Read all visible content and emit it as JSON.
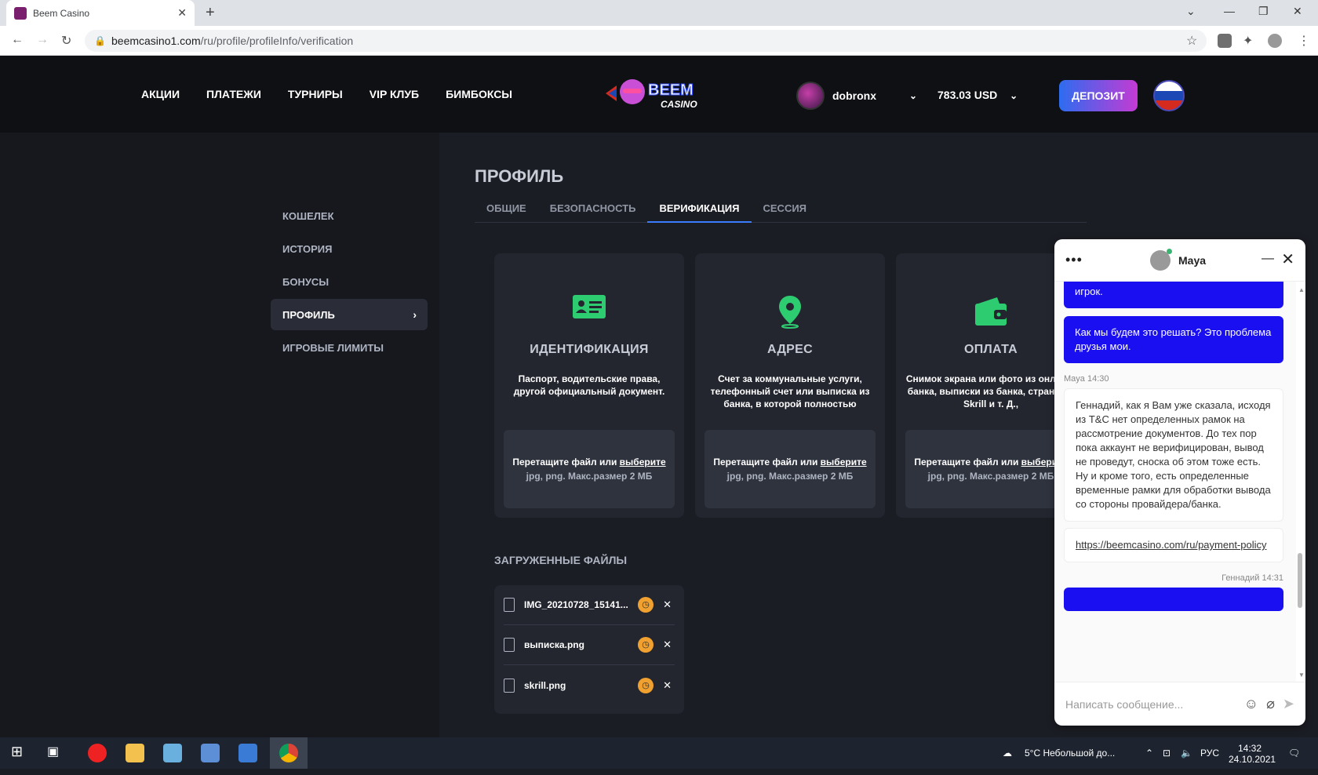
{
  "browser": {
    "tab_title": "Beem Casino",
    "tab_close": "✕",
    "new_tab": "+",
    "url_host": "beemcasino1.com",
    "url_path": "/ru/profile/profileInfo/verification"
  },
  "header": {
    "nav": [
      "АКЦИИ",
      "ПЛАТЕЖИ",
      "ТУРНИРЫ",
      "VIP КЛУБ",
      "БИМБОКСЫ"
    ],
    "logo_text_1": "BEEM",
    "logo_text_2": "CASINO",
    "username": "dobronx",
    "balance": "783.03 USD",
    "deposit_label": "ДЕПОЗИТ"
  },
  "sidebar": {
    "items": [
      {
        "label": "КОШЕЛЕК"
      },
      {
        "label": "ИСТОРИЯ"
      },
      {
        "label": "БОНУСЫ"
      },
      {
        "label": "ПРОФИЛЬ",
        "active": true
      },
      {
        "label": "ИГРОВЫЕ ЛИМИТЫ"
      }
    ]
  },
  "profile": {
    "title": "ПРОФИЛЬ",
    "tabs": [
      "ОБЩИЕ",
      "БЕЗОПАСНОСТЬ",
      "ВЕРИФИКАЦИЯ",
      "СЕССИЯ"
    ],
    "active_tab": "ВЕРИФИКАЦИЯ"
  },
  "cards": [
    {
      "title": "ИДЕНТИФИКАЦИЯ",
      "desc": "Паспорт, водительские права, другой официальный документ.",
      "icon": "id-card-icon"
    },
    {
      "title": "АДРЕС",
      "desc": "Счет за коммунальные услуги, телефонный счет или выписка из банка, в которой полностью",
      "icon": "location-pin-icon"
    },
    {
      "title": "ОПЛАТА",
      "desc": "Снимок экрана или фото из онлайн-банка, выписки из банка, страницы Skrill и т. Д.,",
      "icon": "wallet-icon"
    }
  ],
  "dropzone": {
    "text": "Перетащите файл или ",
    "link": "выберите",
    "hint": "jpg, png. Макс.размер 2 МБ"
  },
  "files": {
    "title": "ЗАГРУЖЕННЫЕ ФАЙЛЫ",
    "items": [
      "IMG_20210728_15141...",
      "выписка.png",
      "skrill.png"
    ]
  },
  "chat": {
    "agent": "Maya",
    "msg_partial": "игрок.",
    "msg_out_1": "Как мы будем это решать? Это проблема друзья мои.",
    "meta_in": "Maya 14:30",
    "msg_in_1": "Геннадий, как я Вам уже сказала, исходя из T&C нет определенных рамок на рассмотрение документов. До тех пор пока аккаунт не верифицирован, вывод не проведут, сноска об этом тоже есть. Ну и кроме того, есть определенные временные рамки для обработки вывода со стороны провайдера/банка.",
    "msg_in_link": "https://beemcasino.com/ru/payment-policy",
    "meta_out": "Геннадий 14:31",
    "input_placeholder": "Написать сообщение..."
  },
  "taskbar": {
    "weather": "5°C  Небольшой до...",
    "lang": "РУС",
    "time": "14:32",
    "date": "24.10.2021"
  },
  "colors": {
    "accent_green": "#2ecc71",
    "deposit_start": "#2d6cf0",
    "deposit_end": "#c43bd4",
    "chat_blue": "#1a0ff0",
    "clock_orange": "#f0a12f"
  }
}
